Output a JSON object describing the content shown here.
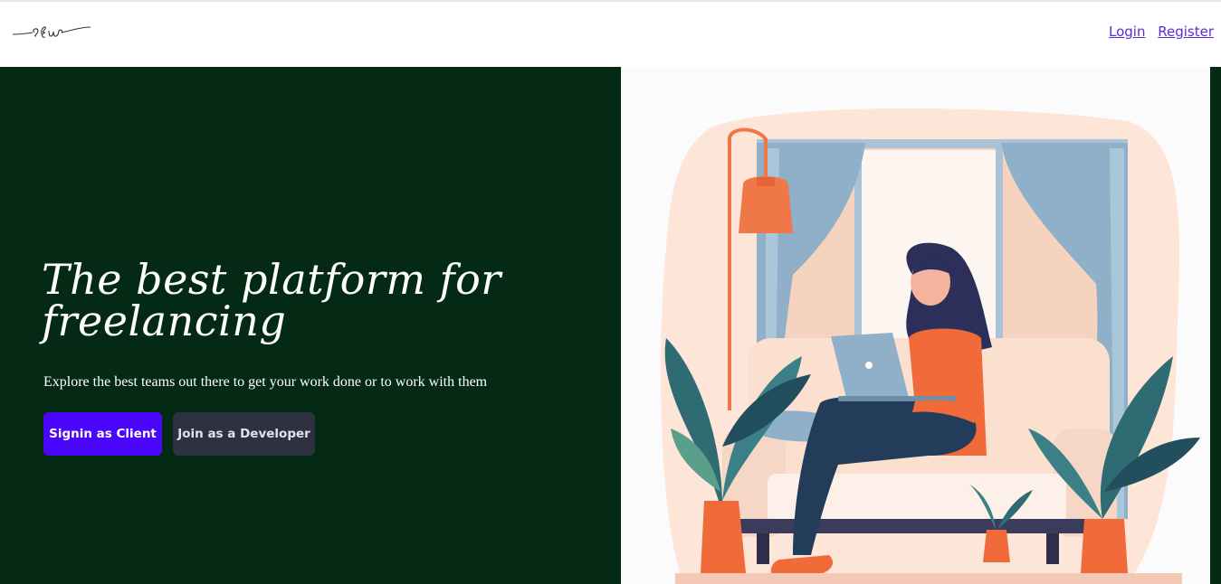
{
  "navbar": {
    "logo_icon": "script-logo-icon",
    "links": {
      "login": "Login",
      "register": "Register"
    }
  },
  "hero": {
    "title": "The best platform for freelancing",
    "subtitle": "Explore the best teams out there to get your work done or to work with them",
    "buttons": {
      "client": "Signin as Client",
      "developer": "Join as a Developer"
    },
    "illustration": "woman-working-on-laptop-illustration"
  },
  "colors": {
    "hero_bg": "#042a16",
    "primary_button": "#4a06fb",
    "secondary_button": "#2d3140",
    "link": "#5b2bd6"
  }
}
